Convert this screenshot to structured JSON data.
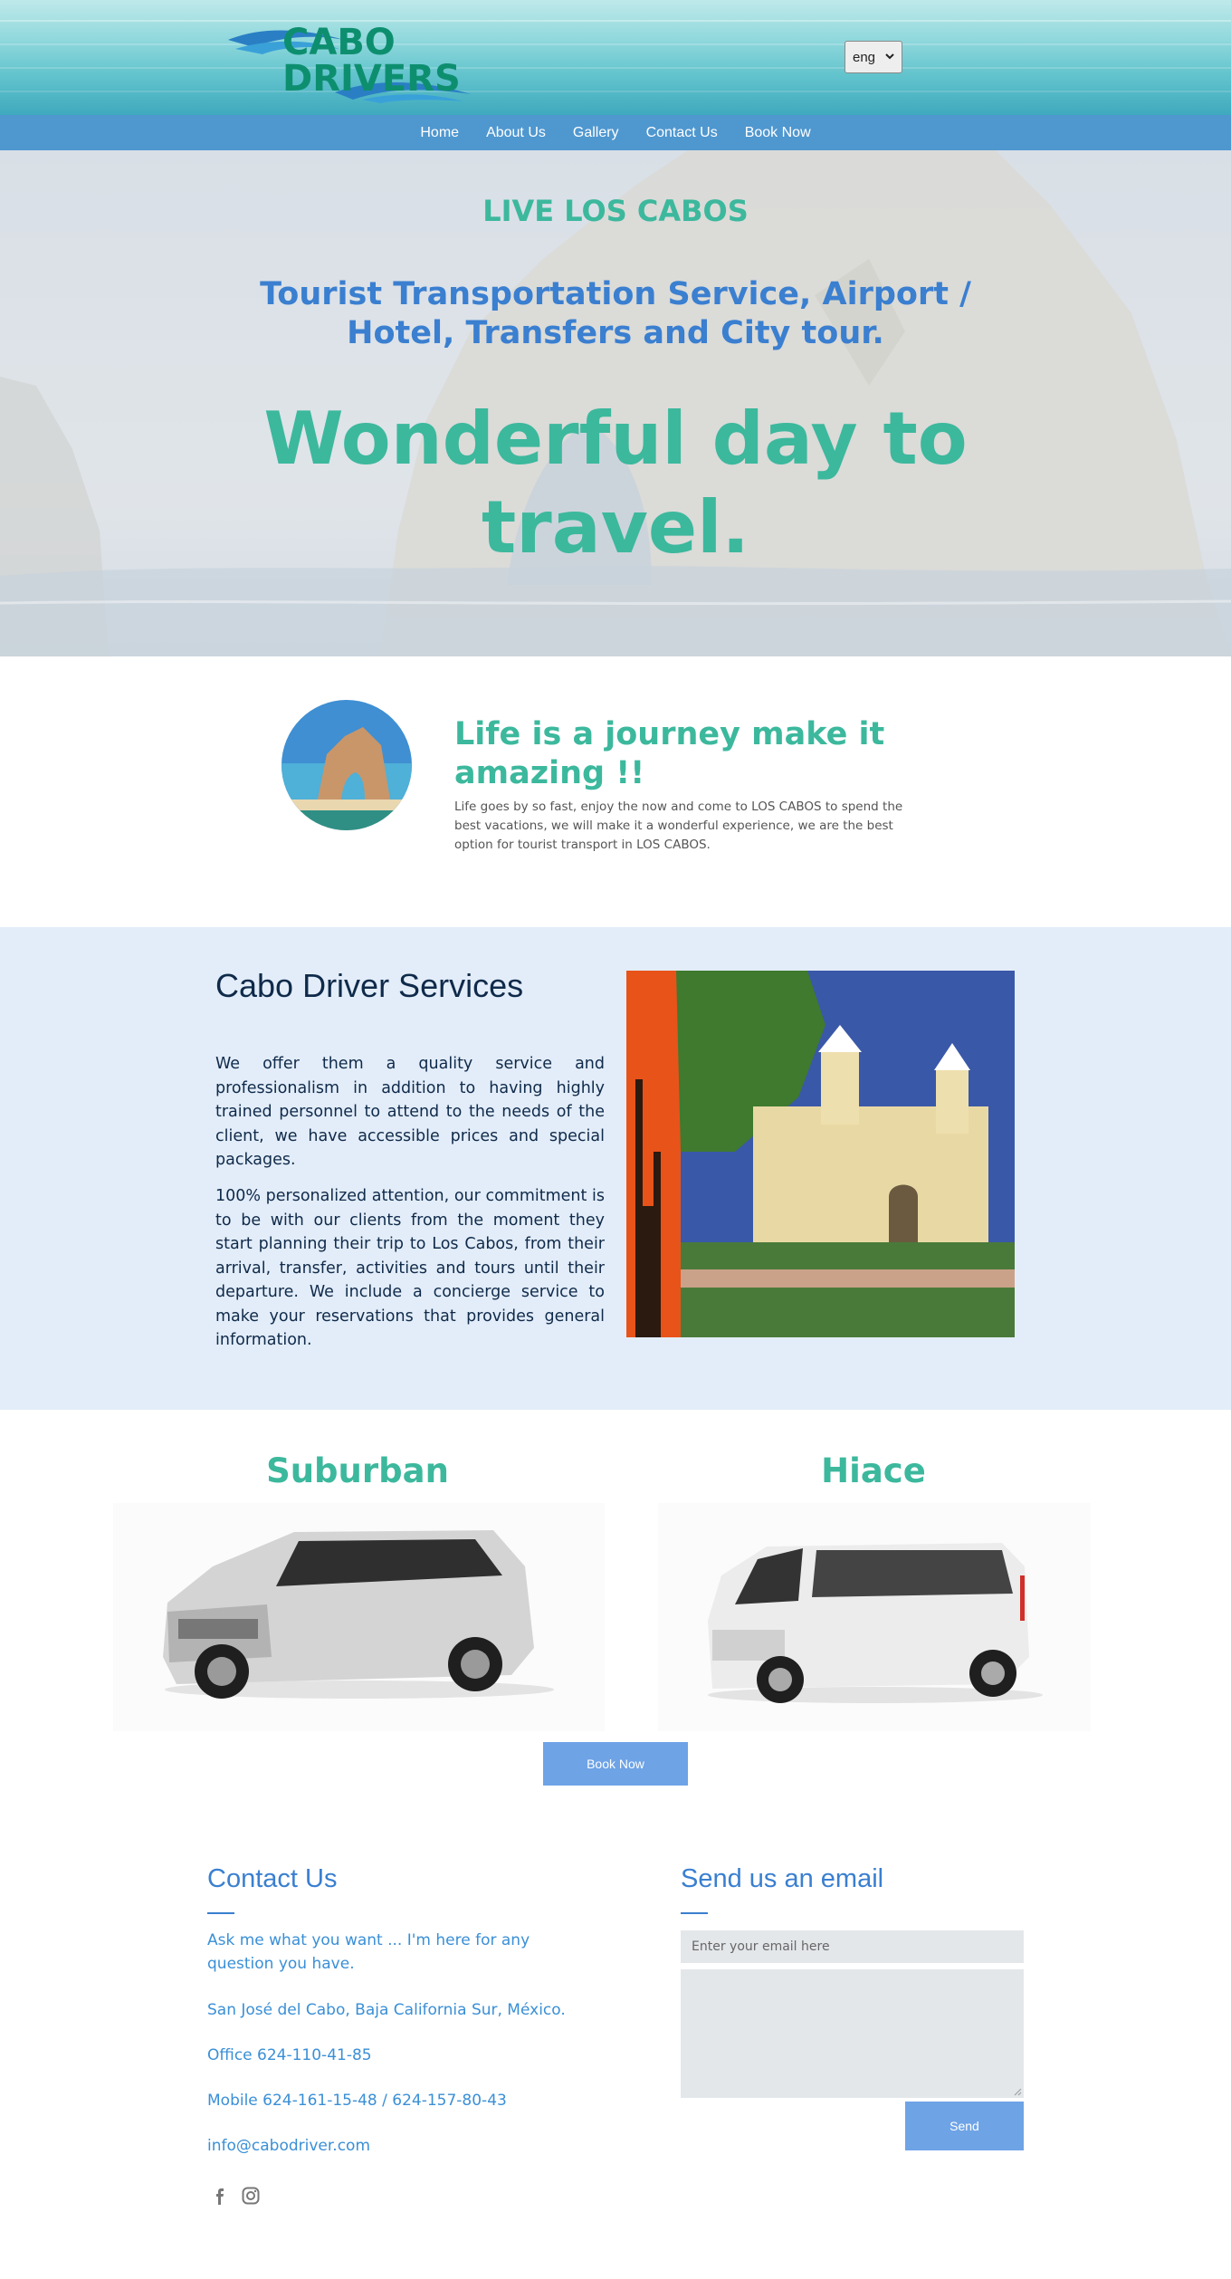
{
  "header": {
    "logo_text_top": "CABO",
    "logo_text_bottom": "DRIVERS",
    "language_selected": "eng"
  },
  "nav": {
    "items": [
      "Home",
      "About Us",
      "Gallery",
      "Contact Us",
      "Book Now"
    ]
  },
  "hero": {
    "kicker": "LIVE LOS CABOS",
    "subtitle": "Tourist Transportation Service, Airport / Hotel, Transfers and City tour.",
    "title": "Wonderful day to travel."
  },
  "journey": {
    "title": "Life is a journey make it amazing !!",
    "text": "Life goes by so fast, enjoy the now and come to LOS CABOS to spend the best vacations, we will make it a wonderful experience, we are the best option for tourist transport in LOS CABOS."
  },
  "services": {
    "title": "Cabo Driver Services",
    "paragraph1": "We offer them a quality service and professionalism in addition to having highly trained personnel to attend to the needs of the client, we have accessible prices and special packages.",
    "paragraph2": "100% personalized attention, our commitment is to be with our clients from the moment they start planning their trip to Los Cabos, from their arrival, transfer, activities and tours until their departure. We include a concierge service to make your reservations that provides general information."
  },
  "vehicles": {
    "left_title": "Suburban",
    "right_title": "Hiace",
    "book_label": "Book Now"
  },
  "contact": {
    "title": "Contact Us",
    "intro": "Ask me what you want ... I'm here for any question you have.",
    "address": "San José del Cabo, Baja California Sur, México.",
    "office": "Office 624-110-41-85",
    "mobile": "Mobile 624-161-15-48 / 624-157-80-43",
    "email": "info@cabodriver.com"
  },
  "email_form": {
    "title": "Send us an email",
    "email_placeholder": "Enter your email here",
    "send_label": "Send"
  },
  "colors": {
    "accent_green": "#3cb89d",
    "accent_blue": "#3a7fd0",
    "nav_blue": "#4f97cf",
    "button_blue": "#6ea3e6",
    "services_bg": "#e3edf9"
  },
  "icons": [
    "chevron-down-icon",
    "facebook-icon",
    "instagram-icon"
  ]
}
